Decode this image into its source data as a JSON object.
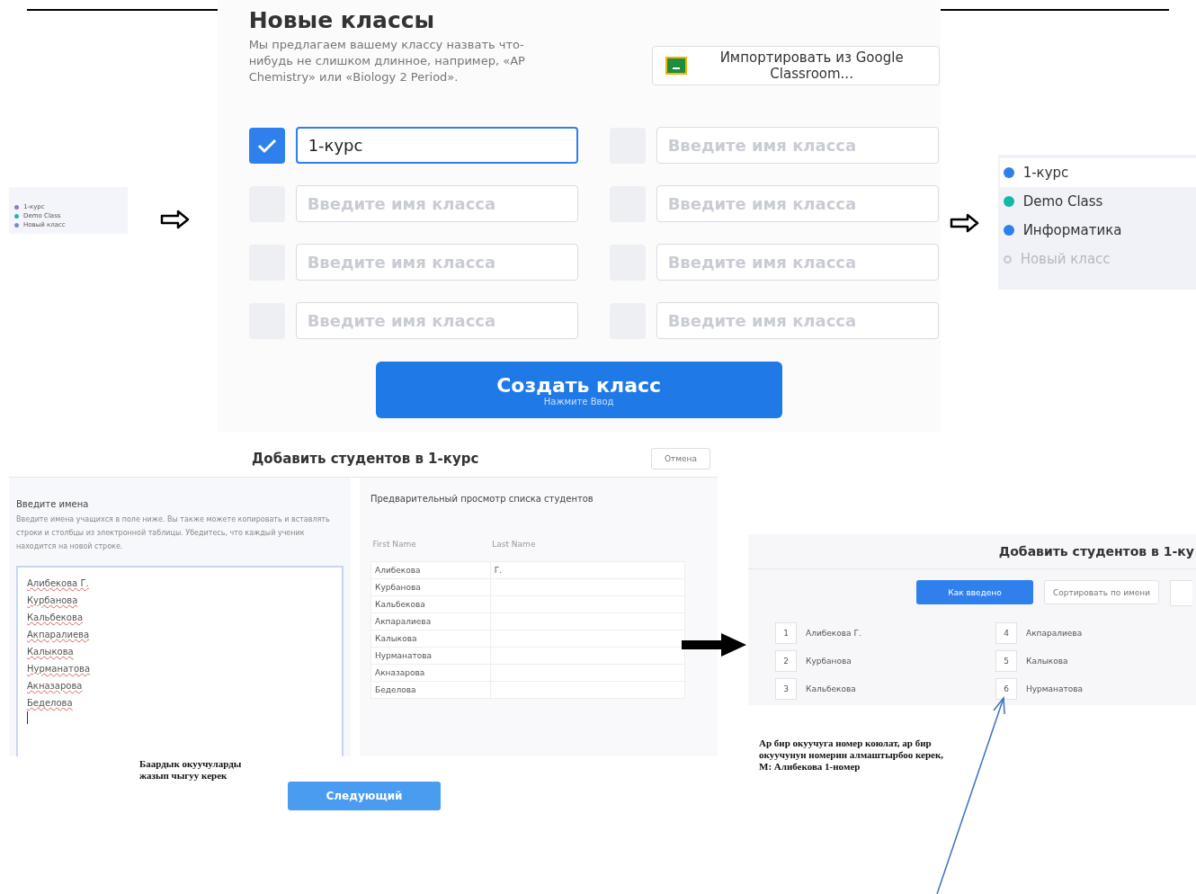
{
  "mini_sidebar": {
    "items": [
      {
        "label": "1-курс",
        "color": "#8e7cc3"
      },
      {
        "label": "Demo Class",
        "color": "#26b5a6"
      },
      {
        "label": "Новый класс",
        "color": "#7b8fc7"
      }
    ]
  },
  "new_classes": {
    "title": "Новые классы",
    "description": "Мы предлагаем вашему классу назвать что-нибудь не слишком длинное, например, «AP Chemistry» или «Biology 2 Period».",
    "import_button": "Импортировать из Google Classroom...",
    "fields": [
      {
        "checked": true,
        "value": "1-курс"
      },
      {
        "checked": false,
        "placeholder": "Введите имя класса"
      },
      {
        "checked": false,
        "placeholder": "Введите имя класса"
      },
      {
        "checked": false,
        "placeholder": "Введите имя класса"
      },
      {
        "checked": false,
        "placeholder": "Введите имя класса"
      },
      {
        "checked": false,
        "placeholder": "Введите имя класса"
      },
      {
        "checked": false,
        "placeholder": "Введите имя класса"
      },
      {
        "checked": false,
        "placeholder": "Введите имя класса"
      }
    ],
    "create_button": {
      "label": "Создать класс",
      "hint": "Нажмите Ввод"
    }
  },
  "class_list": {
    "items": [
      {
        "label": "1-курс",
        "color": "#2f80ed",
        "selected": true,
        "kind": "class"
      },
      {
        "label": "Demo Class",
        "color": "#14b8a6",
        "selected": false,
        "kind": "class"
      },
      {
        "label": "Информатика",
        "color": "#2f80ed",
        "selected": false,
        "kind": "class"
      },
      {
        "label": "Новый класс",
        "color": "#c4c8d0",
        "selected": false,
        "kind": "new"
      }
    ]
  },
  "add_students": {
    "title": "Добавить студентов в 1-курс",
    "cancel_button": "Отмена",
    "input_title": "Введите имена",
    "input_help": "Введите имена учащихся в поле ниже. Вы также можете копировать и вставлять строки и столбцы из электронной таблицы. Убедитесь, что каждый ученик находится на новой строке.",
    "names": [
      "Алибекова Г.",
      "Курбанова",
      "Кальбекова",
      "Акпаралиева",
      "Калыкова",
      "Нурманатова",
      "Акназарова",
      "Беделова"
    ],
    "preview_title": "Предварительный просмотр списка студентов",
    "columns": [
      "First Name",
      "Last Name"
    ],
    "rows": [
      [
        "Алибекова",
        "Г."
      ],
      [
        "Курбанова",
        ""
      ],
      [
        "Кальбекова",
        ""
      ],
      [
        "Акпаралиева",
        ""
      ],
      [
        "Калыкова",
        ""
      ],
      [
        "Нурманатова",
        ""
      ],
      [
        "Акназарова",
        ""
      ],
      [
        "Беделова",
        ""
      ]
    ],
    "next_button": "Следующий"
  },
  "note_left": [
    "Баардык окуучуларды",
    "жазып чыгуу керек"
  ],
  "numbered": {
    "title": "Добавить студентов в 1-ку",
    "sort_buttons": [
      {
        "label": "Как введено",
        "selected": true
      },
      {
        "label": "Сортировать по имени",
        "selected": false
      }
    ],
    "students": [
      {
        "number": "1",
        "name": "Алибекова Г."
      },
      {
        "number": "2",
        "name": "Курбанова"
      },
      {
        "number": "3",
        "name": "Кальбекова"
      },
      {
        "number": "4",
        "name": "Акпаралиева"
      },
      {
        "number": "5",
        "name": "Калыкова"
      },
      {
        "number": "6",
        "name": "Нурманатова"
      }
    ]
  },
  "note_right": [
    "Ар бир окуучуга номер коюлат, ар бир",
    "окуучунун номерин алмаштырбоо керек,",
    "М: Алибекова 1-номер"
  ]
}
